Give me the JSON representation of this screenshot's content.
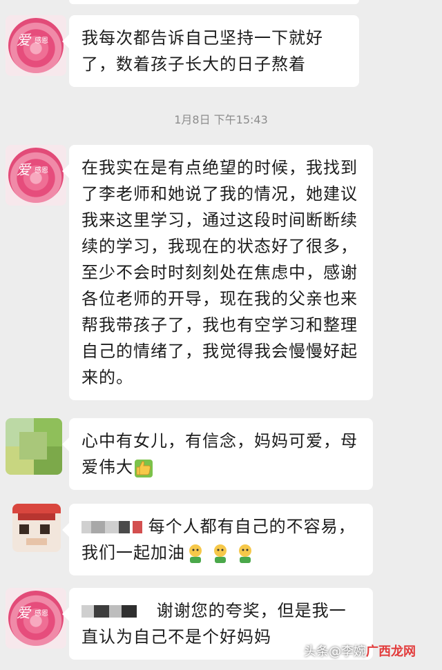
{
  "messages": [
    {
      "text": "我每次都告诉自己坚持一下就好了，数着孩子长大的日子熬着"
    },
    {
      "text": "在我实在是有点绝望的时候，我找到了李老师和她说了我的情况，她建议我来这里学习，通过这段时间断断续续的学习，我现在的状态好了很多，至少不会时时刻刻处在焦虑中，感谢各位老师的开导，现在我的父亲也来帮我带孩子了，我也有空学习和整理自己的情绪了，我觉得我会慢慢好起来的。"
    },
    {
      "text": "心中有女儿，有信念，妈妈可爱，母爱伟大"
    },
    {
      "text": "每个人都有自己的不容易，我们一起加油"
    },
    {
      "text": "谢谢您的夸奖，但是我一直认为自己不是个好妈妈"
    }
  ],
  "timestamp": "1月8日 下午15:43",
  "avatar_glyphs": {
    "main": "爱",
    "sub": "感恩"
  },
  "watermark": {
    "prefix": "头条",
    "middle": "@李婉",
    "brand": "广西龙网"
  },
  "colors": {
    "background": "#ededed",
    "bubble": "#ffffff",
    "time": "#8c8c8c"
  }
}
